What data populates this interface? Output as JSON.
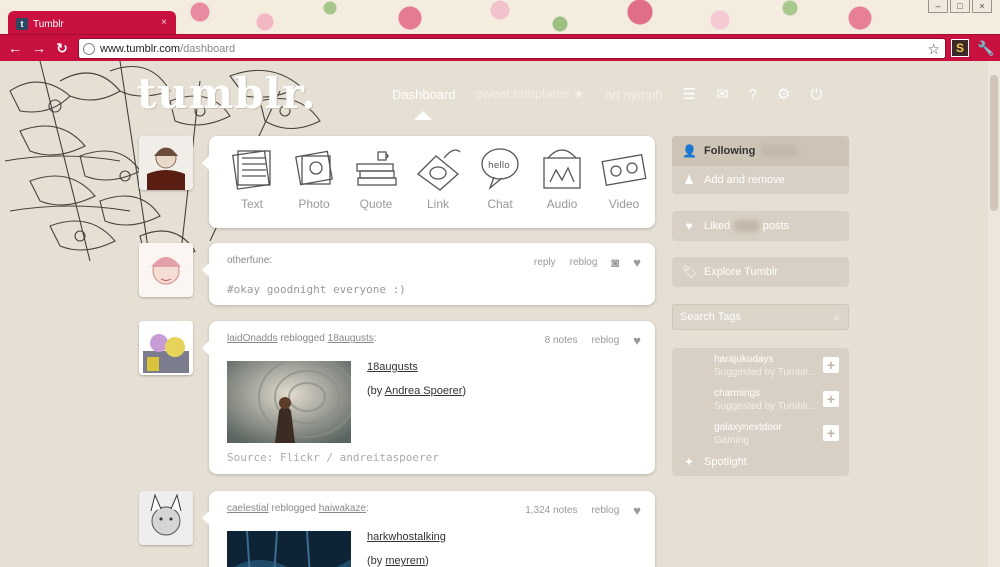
{
  "browser": {
    "tab_title": "Tumblr",
    "tab_favicon": "t",
    "tab_close": "×",
    "window_controls": [
      "–",
      "□",
      "×"
    ],
    "back": "←",
    "forward": "→",
    "reload": "↻",
    "url_host": "www.tumblr.com",
    "url_path": "/dashboard",
    "star": "☆",
    "extension_icon": "S",
    "wrench": "🔧",
    "accent_color": "#c8113e"
  },
  "header": {
    "logo": "tumblr.",
    "nav_items": [
      "Dashboard",
      "sweet templates ★",
      "art nymph"
    ],
    "nav_icons": [
      "list-icon",
      "mail-icon",
      "help-icon",
      "gear-icon",
      "power-icon"
    ]
  },
  "composer": {
    "post_types": [
      "Text",
      "Photo",
      "Quote",
      "Link",
      "Chat",
      "Audio",
      "Video"
    ]
  },
  "posts": [
    {
      "author": "otherfune",
      "colon": ":",
      "controls": [
        "reply",
        "reblog"
      ],
      "body": "#okay goodnight everyone :)"
    },
    {
      "author": "laidOnadds",
      "reblogged": "reblogged",
      "source_blog": "18augusts",
      "colon": ":",
      "notes": "8 notes",
      "reblog": "reblog",
      "link": "18augusts",
      "by_prefix": "(by ",
      "by_name": "Andrea Spoerer",
      "by_suffix": ")",
      "source": "Source: Flickr / andreitaspoerer"
    },
    {
      "author": "caelestial",
      "reblogged": "reblogged",
      "source_blog": "haiwakaze",
      "colon": ":",
      "notes": "1,324 notes",
      "reblog": "reblog",
      "link": "harkwhostalking",
      "by_prefix": "(by ",
      "by_name": "meyrem",
      "by_suffix": ")"
    }
  ],
  "sidebar": {
    "following_label": "Following",
    "add_remove": "Add and remove",
    "liked_prefix": "Liked",
    "liked_suffix": "posts",
    "explore": "Explore Tumblr",
    "search_placeholder": "Search Tags",
    "tags": [
      {
        "name": "harajukudays",
        "sub": "Suggested by Tumblr..."
      },
      {
        "name": "charmings",
        "sub": "Suggested by Tumblr..."
      },
      {
        "name": "galaxynextdoor",
        "sub": "Gaming"
      }
    ],
    "spotlight": "Spotlight"
  }
}
